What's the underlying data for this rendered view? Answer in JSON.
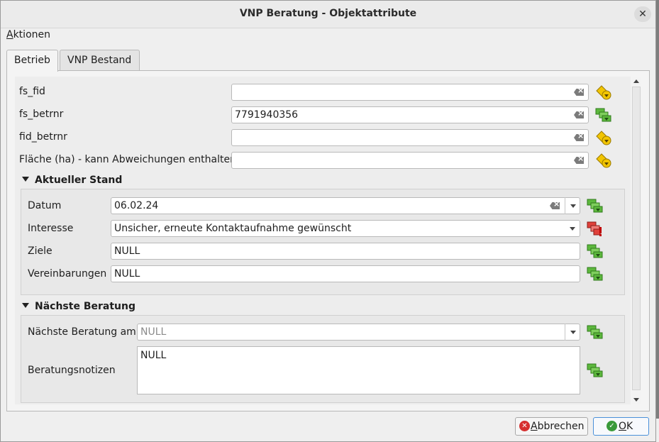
{
  "window": {
    "title": "VNP Beratung - Objektattribute",
    "close_icon": "close-icon"
  },
  "menu": {
    "aktionen": {
      "accel": "A",
      "rest": "ktionen"
    }
  },
  "tabs": [
    {
      "label": "Betrieb",
      "active": true
    },
    {
      "label": "VNP Bestand",
      "active": false
    }
  ],
  "fields": {
    "fs_fid": {
      "label": "fs_fid",
      "value": ""
    },
    "fs_betrnr": {
      "label": "fs_betrnr",
      "value": "7791940356"
    },
    "fid_betrnr": {
      "label": "fid_betrnr",
      "value": ""
    },
    "flaeche": {
      "label": "Fläche (ha) - kann Abweichungen enthalten",
      "value": ""
    }
  },
  "aktueller_stand": {
    "header": "Aktueller Stand",
    "datum": {
      "label": "Datum",
      "value": "06.02.24"
    },
    "interesse": {
      "label": "Interesse",
      "value": "Unsicher, erneute Kontaktaufnahme gewünscht"
    },
    "ziele": {
      "label": "Ziele",
      "value": "NULL"
    },
    "vereinbarungen": {
      "label": "Vereinbarungen",
      "value": "NULL"
    }
  },
  "naechste_beratung": {
    "header": "Nächste Beratung",
    "am": {
      "label": "Nächste Beratung am",
      "value": "NULL"
    },
    "notizen": {
      "label": "Beratungsnotizen",
      "value": "NULL"
    }
  },
  "buttons": {
    "cancel": {
      "accel": "A",
      "rest": "bbrechen"
    },
    "ok": {
      "accel": "O",
      "rest": "K"
    }
  },
  "colors": {
    "accent": "#4a90d9",
    "cancel_icon": "#d63030",
    "ok_icon": "#3a9a3a",
    "yellow_icon": "#f2c500",
    "green_icon": "#5db83d",
    "red_icon": "#e0403a"
  }
}
